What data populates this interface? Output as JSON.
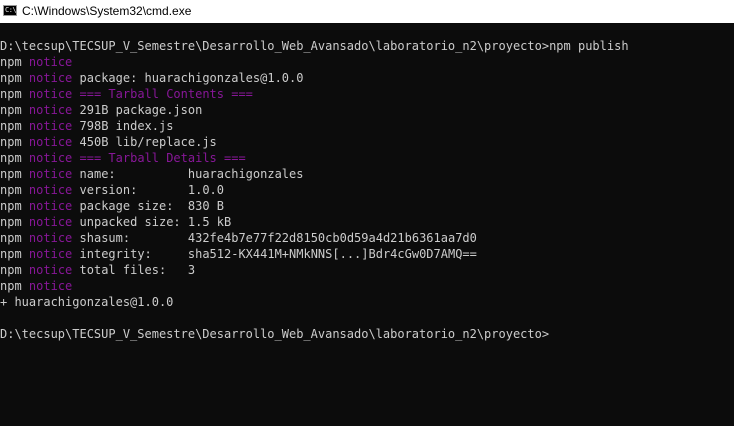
{
  "window": {
    "title": "C:\\Windows\\System32\\cmd.exe",
    "icon": "cmd-icon",
    "icon_glyph": "C:\\",
    "colors": {
      "background": "#0c0c0c",
      "text": "#cccccc",
      "notice": "#881798",
      "titlebar": "#ffffff"
    }
  },
  "console": {
    "blank_top": "",
    "command_line": "D:\\tecsup\\TECSUP_V_Semestre\\Desarrollo_Web_Avansado\\laboratorio_n2\\proyecto>npm publish",
    "npm_lines": [
      {
        "prefix": "npm",
        "level": "notice",
        "text": "",
        "purple": false
      },
      {
        "prefix": "npm",
        "level": "notice",
        "text": "package: huarachigonzales@1.0.0",
        "purple": false
      },
      {
        "prefix": "npm",
        "level": "notice",
        "text": "=== Tarball Contents ===",
        "purple": true
      },
      {
        "prefix": "npm",
        "level": "notice",
        "text": "291B package.json",
        "purple": false
      },
      {
        "prefix": "npm",
        "level": "notice",
        "text": "798B index.js",
        "purple": false
      },
      {
        "prefix": "npm",
        "level": "notice",
        "text": "450B lib/replace.js",
        "purple": false
      },
      {
        "prefix": "npm",
        "level": "notice",
        "text": "=== Tarball Details ===",
        "purple": true
      },
      {
        "prefix": "npm",
        "level": "notice",
        "text": "name:          huarachigonzales",
        "purple": false
      },
      {
        "prefix": "npm",
        "level": "notice",
        "text": "version:       1.0.0",
        "purple": false
      },
      {
        "prefix": "npm",
        "level": "notice",
        "text": "package size:  830 B",
        "purple": false
      },
      {
        "prefix": "npm",
        "level": "notice",
        "text": "unpacked size: 1.5 kB",
        "purple": false
      },
      {
        "prefix": "npm",
        "level": "notice",
        "text": "shasum:        432fe4b7e77f22d8150cb0d59a4d21b6361aa7d0",
        "purple": false
      },
      {
        "prefix": "npm",
        "level": "notice",
        "text": "integrity:     sha512-KX441M+NMkNNS[...]Bdr4cGw0D7AMQ==",
        "purple": false
      },
      {
        "prefix": "npm",
        "level": "notice",
        "text": "total files:   3",
        "purple": false
      },
      {
        "prefix": "npm",
        "level": "notice",
        "text": "",
        "purple": false
      }
    ],
    "published_line": "+ huarachigonzales@1.0.0",
    "blank_after": "",
    "prompt_line": "D:\\tecsup\\TECSUP_V_Semestre\\Desarrollo_Web_Avansado\\laboratorio_n2\\proyecto>"
  }
}
